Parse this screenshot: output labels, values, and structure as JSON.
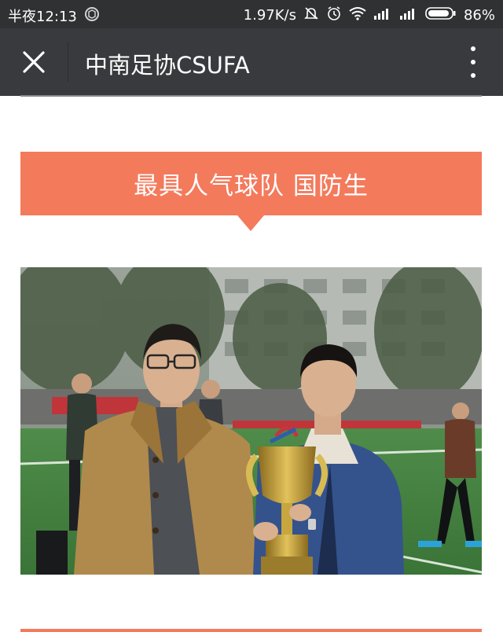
{
  "status_bar": {
    "time": "半夜12:13",
    "net_speed": "1.97K/s",
    "battery": "86%"
  },
  "nav": {
    "title": "中南足协CSUFA"
  },
  "article": {
    "banner_title": "最具人气球队 国防生"
  },
  "colors": {
    "accent": "#f47a5c",
    "nav_bg": "#393a3e",
    "status_bg": "#2f3133"
  }
}
